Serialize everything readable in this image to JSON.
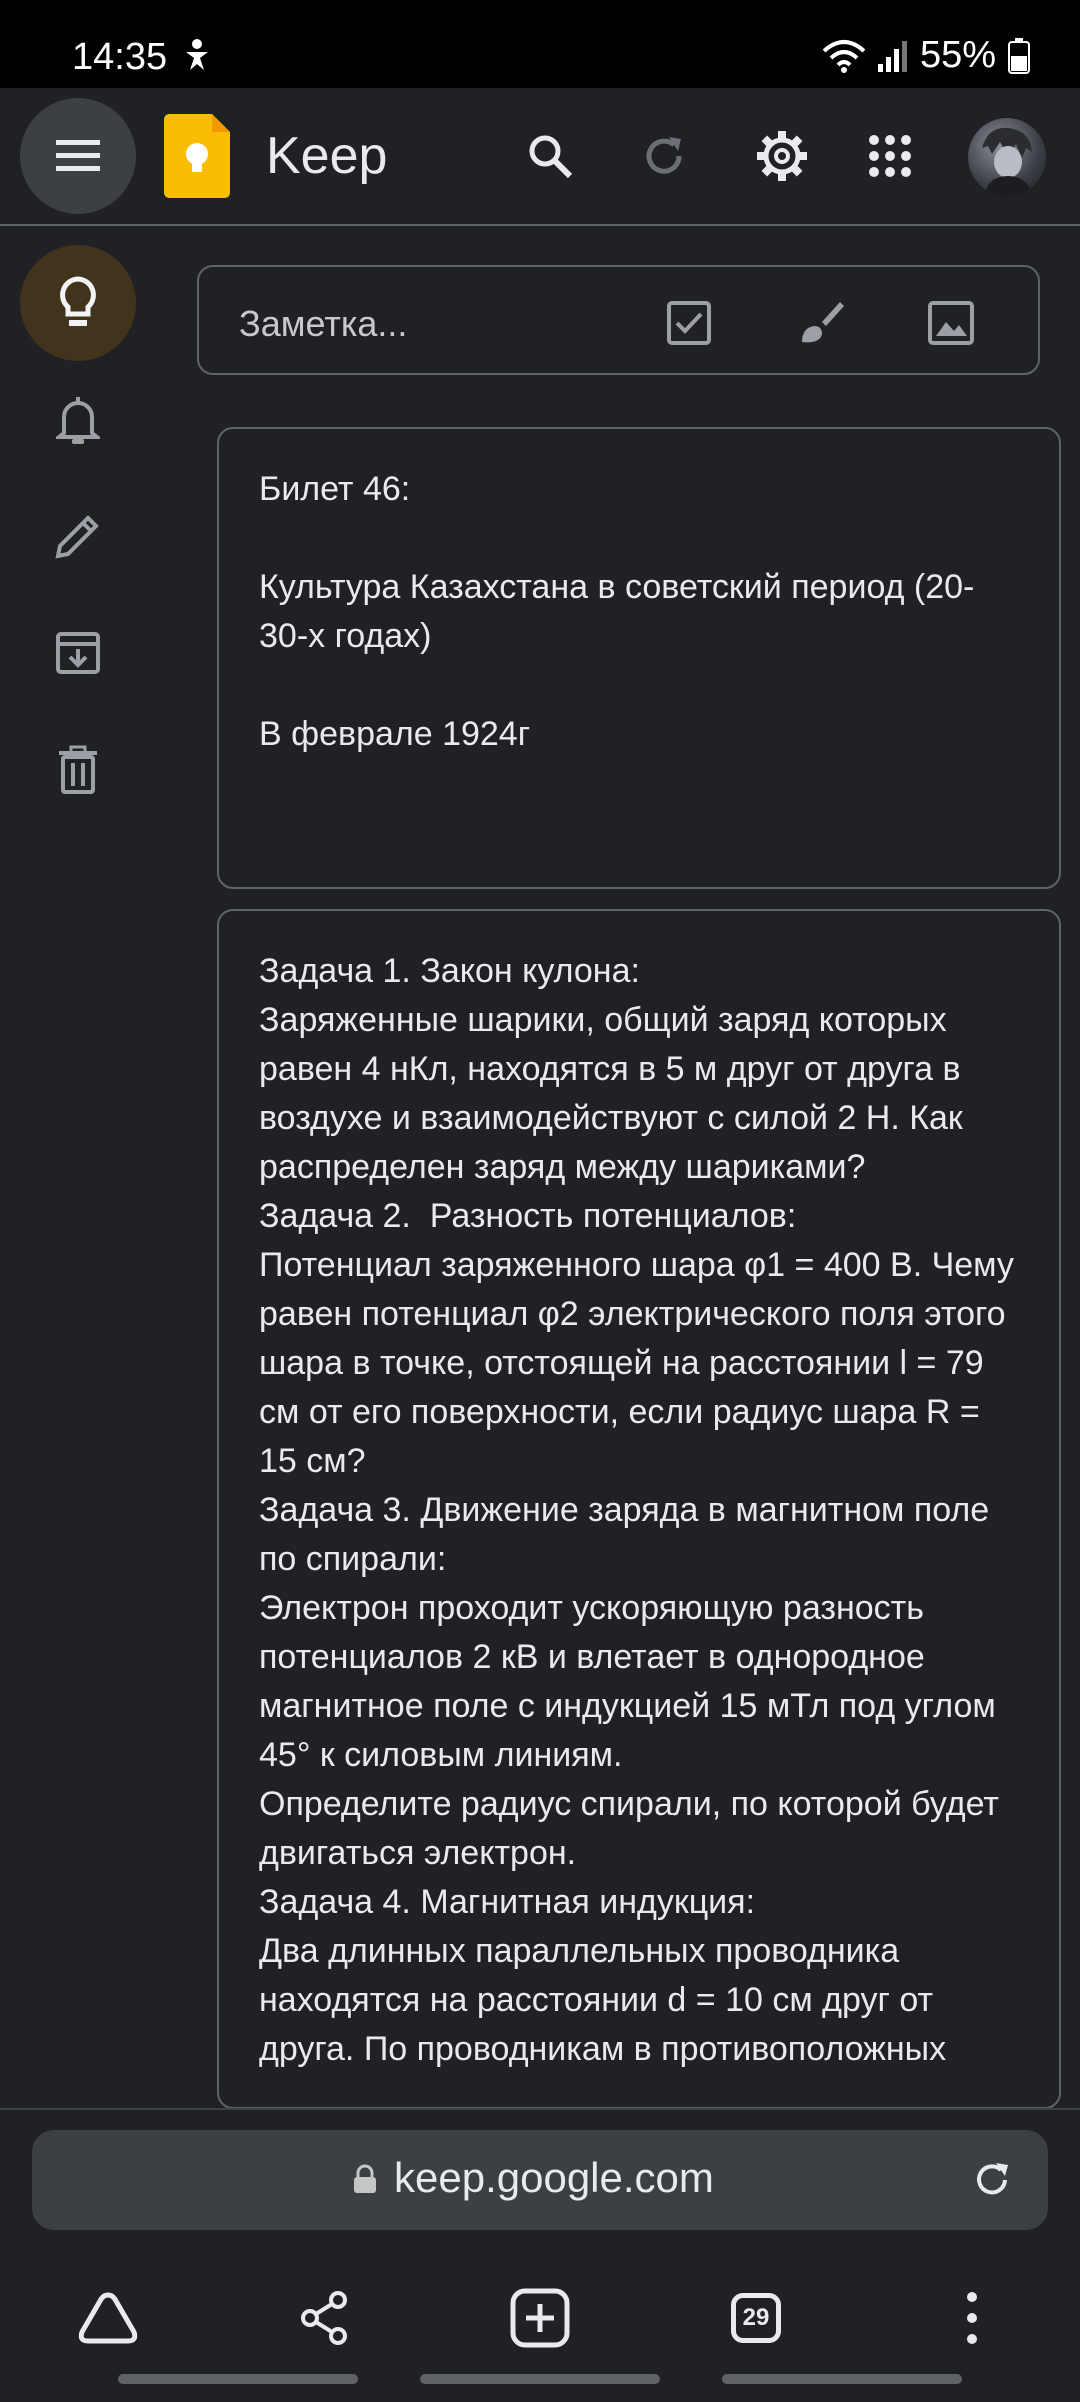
{
  "status_bar": {
    "time": "14:35",
    "battery": "55%"
  },
  "header": {
    "app_title": "Keep",
    "icons": [
      "menu-icon",
      "keep-logo",
      "search-icon",
      "refresh-icon",
      "settings-gear-icon",
      "apps-grid-icon",
      "account-avatar"
    ]
  },
  "sidebar": {
    "items": [
      "notes",
      "reminders",
      "edit-labels",
      "archive",
      "trash"
    ]
  },
  "take_note": {
    "placeholder": "Заметка..."
  },
  "notes": [
    {
      "text": "Билет 46:\n\nКультура Казахстана в советский период (20-30-х годах)\n\nВ феврале 1924г"
    },
    {
      "text": "Задача 1. Закон кулона:\nЗаряженные шарики, общий заряд которых равен 4 нКл, находятся в 5 м друг от друга в воздухе и взаимодействуют с силой 2 Н. Как распределен заряд между шариками?\nЗадача 2.  Разность потенциалов:\nПотенциал заряженного шара φ1 = 400 В. Чему равен потенциал φ2 электрического поля этого шара в точке, отстоящей на расстоянии l = 79 см от его поверхности, если радиус шара R = 15 см?\nЗадача 3. Движение заряда в магнитном поле по спирали:\nЭлектрон проходит ускоряющую разность потенциалов 2 кВ и влетает в однородное магнитное поле с индукцией 15 мТл под углом 45° к силовым линиям.\nОпределите радиус спирали, по которой будет двигаться электрон.\nЗадача 4. Магнитная индукция:\nДва длинных параллельных проводника находятся на расстоянии d = 10 см друг от друга. По проводникам в противоположных"
    }
  ],
  "browser": {
    "url": "keep.google.com",
    "tab_count": "29"
  },
  "colors": {
    "background": "#202124",
    "accent": "#fbbc04",
    "active_nav": "#41331c"
  }
}
